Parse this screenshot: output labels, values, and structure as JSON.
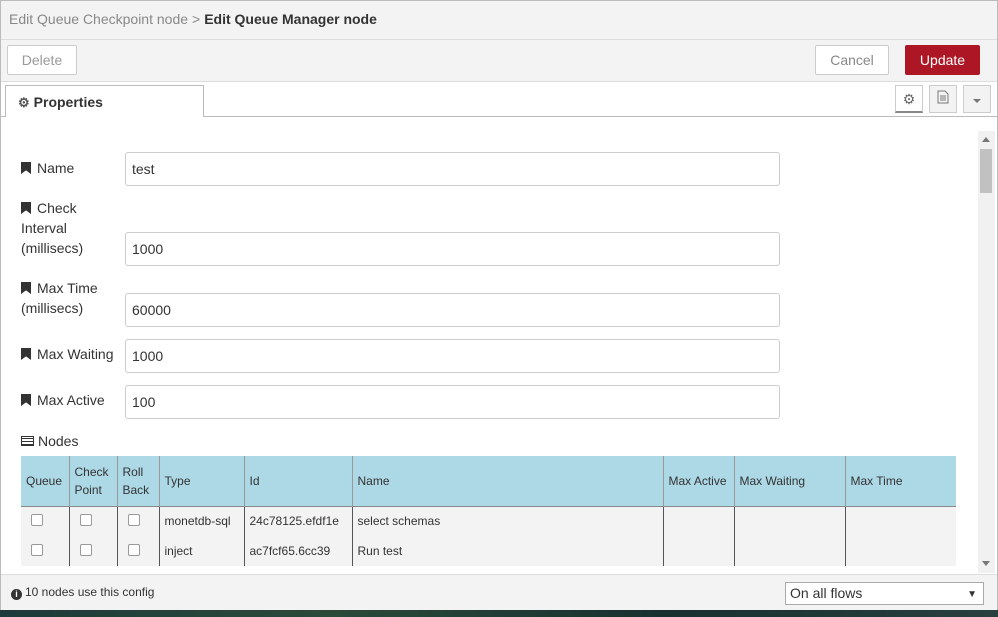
{
  "header": {
    "breadcrumb_parent": "Edit Queue Checkpoint node",
    "separator": ">",
    "title": "Edit Queue Manager node"
  },
  "toolbar": {
    "delete_label": "Delete",
    "cancel_label": "Cancel",
    "update_label": "Update"
  },
  "tabs": {
    "properties_label": "Properties",
    "icons": [
      "gear-icon",
      "document-icon",
      "chevron-down-icon"
    ]
  },
  "form": {
    "name_label": "Name",
    "name_value": "test",
    "check_interval_label_1": "Check",
    "check_interval_label_2": "Interval",
    "check_interval_label_3": "(millisecs)",
    "check_interval_value": "1000",
    "max_time_label_1": "Max Time",
    "max_time_label_2": "(millisecs)",
    "max_time_value": "60000",
    "max_waiting_label": "Max Waiting",
    "max_waiting_value": "1000",
    "max_active_label": "Max Active",
    "max_active_value": "100",
    "nodes_label": "Nodes"
  },
  "table": {
    "headers": {
      "queue": "Queue",
      "check_point_1": "Check",
      "check_point_2": "Point",
      "roll_back_1": "Roll",
      "roll_back_2": "Back",
      "type": "Type",
      "id": "Id",
      "name": "Name",
      "max_active": "Max Active",
      "max_waiting": "Max Waiting",
      "max_time": "Max Time"
    },
    "rows": [
      {
        "type": "monetdb-sql",
        "id": "24c78125.efdf1e",
        "name": "select schemas"
      },
      {
        "type": "inject",
        "id": "ac7fcf65.6cc39",
        "name": "Run test"
      }
    ]
  },
  "footer": {
    "info_text": "10 nodes use this config",
    "flow_scope": "On all flows"
  },
  "colors": {
    "accent": "#ad1625",
    "table_header": "#add8e6"
  }
}
